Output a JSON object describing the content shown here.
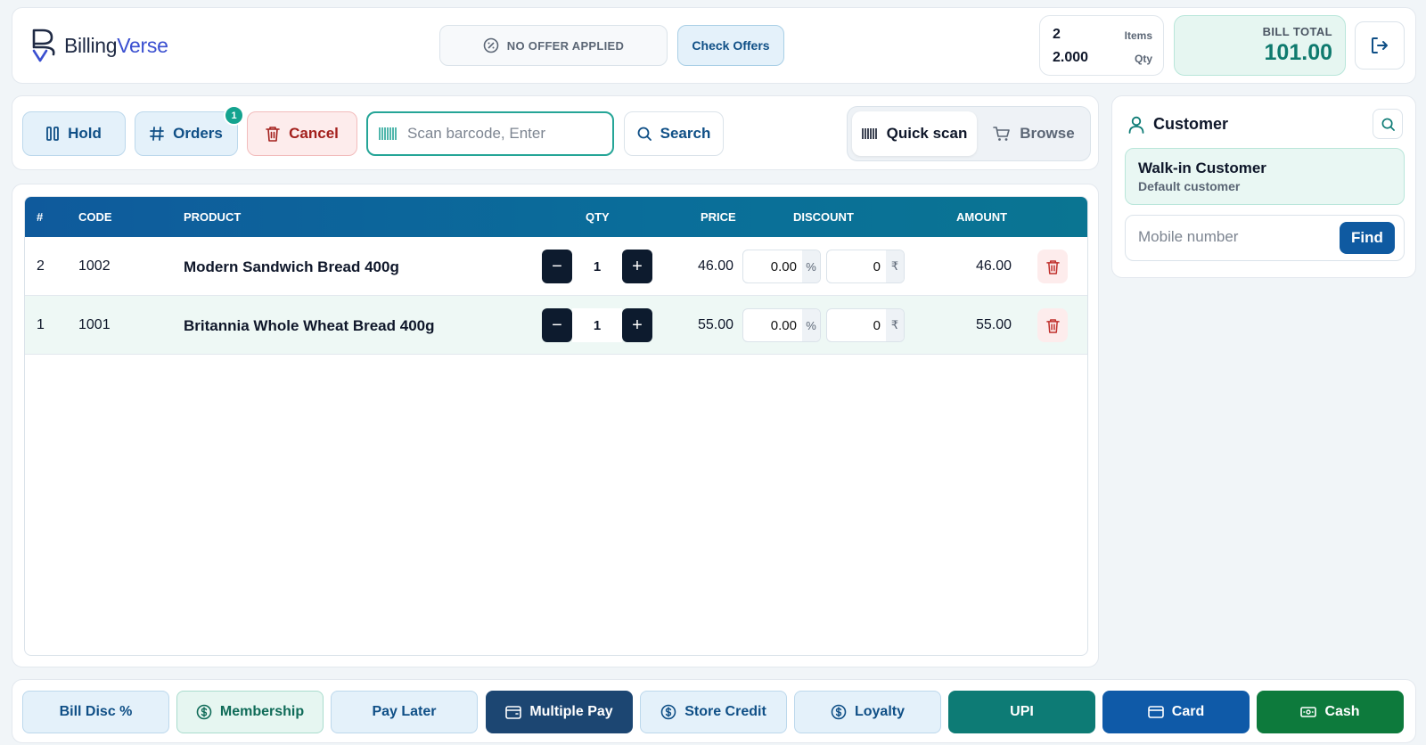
{
  "app": {
    "logo_part1": "Billing",
    "logo_part2": "Verse"
  },
  "header": {
    "offer_status": "NO OFFER APPLIED",
    "check_offers_label": "Check Offers",
    "items_count": "2",
    "items_label": "Items",
    "qty_total": "2.000",
    "qty_label": "Qty",
    "bill_total_label": "BILL TOTAL",
    "bill_total_value": "101.00"
  },
  "toolbar": {
    "hold_label": "Hold",
    "orders_label": "Orders",
    "orders_badge": "1",
    "cancel_label": "Cancel",
    "scan_placeholder": "Scan barcode, Enter",
    "search_label": "Search",
    "quick_scan_label": "Quick scan",
    "browse_label": "Browse"
  },
  "table": {
    "columns": {
      "num": "#",
      "code": "CODE",
      "product": "PRODUCT",
      "qty": "QTY",
      "price": "PRICE",
      "discount": "DISCOUNT",
      "amount": "AMOUNT"
    },
    "rows": [
      {
        "num": "2",
        "code": "1002",
        "product": "Modern Sandwich Bread 400g",
        "qty": "1",
        "price": "46.00",
        "disc_pct": "0.00",
        "pct_unit": "%",
        "disc_amt": "0",
        "amt_unit": "₹",
        "amount": "46.00"
      },
      {
        "num": "1",
        "code": "1001",
        "product": "Britannia Whole Wheat Bread 400g",
        "qty": "1",
        "price": "55.00",
        "disc_pct": "0.00",
        "pct_unit": "%",
        "disc_amt": "0",
        "amt_unit": "₹",
        "amount": "55.00"
      }
    ]
  },
  "customer": {
    "title": "Customer",
    "name": "Walk-in Customer",
    "subtitle": "Default customer",
    "mobile_placeholder": "Mobile number",
    "find_label": "Find"
  },
  "footer": {
    "bill_disc": "Bill Disc %",
    "membership": "Membership",
    "pay_later": "Pay Later",
    "multiple_pay": "Multiple Pay",
    "store_credit": "Store Credit",
    "loyalty": "Loyalty",
    "upi": "UPI",
    "card": "Card",
    "cash": "Cash"
  },
  "colors": {
    "primary_navy": "#0f5aa1",
    "teal_accent": "#0d7b75",
    "danger": "#a3201d",
    "cash_green": "#0d7a3c"
  },
  "icons": [
    "logo-mark-icon",
    "percent-badge-icon",
    "logout-icon",
    "pause-icon",
    "hash-icon",
    "trash-icon",
    "barcode-icon",
    "search-icon",
    "cart-icon",
    "user-icon",
    "dollar-circle-icon",
    "wallet-icon",
    "credit-card-icon",
    "banknote-icon"
  ]
}
